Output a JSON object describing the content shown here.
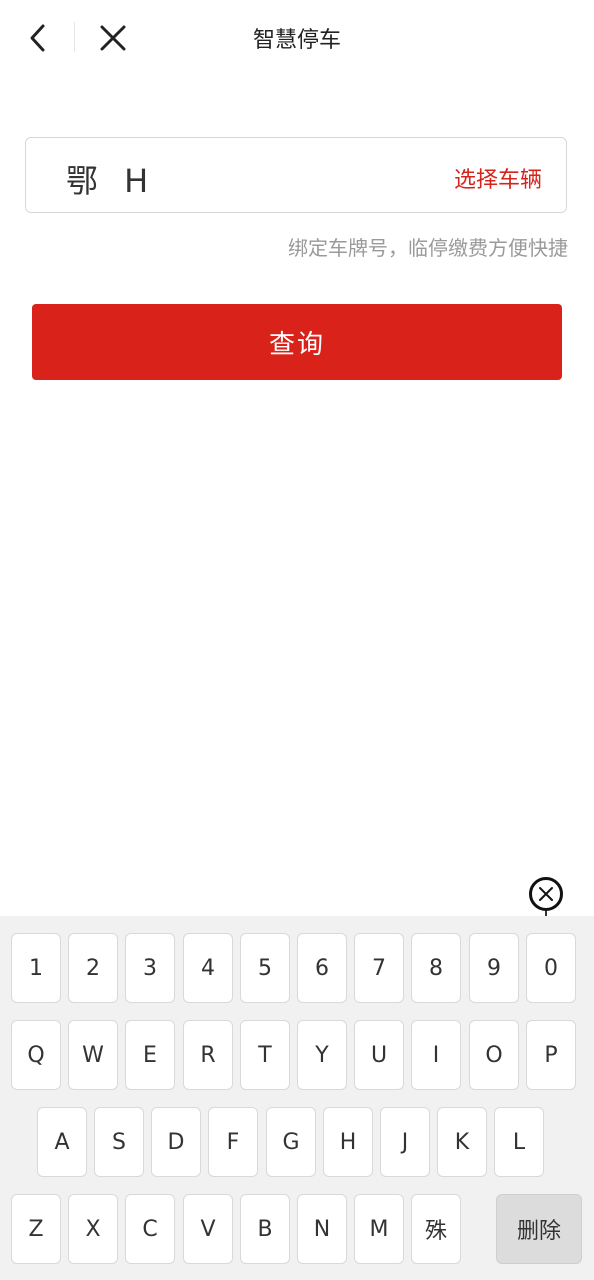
{
  "header": {
    "title": "智慧停车",
    "back_icon": "back-icon",
    "close_icon": "close-icon"
  },
  "plate_input": {
    "value": "鄂 H",
    "select_vehicle_label": "选择车辆",
    "hint": "绑定车牌号，临停缴费方便快捷"
  },
  "query_button": {
    "label": "查询"
  },
  "keyboard": {
    "dismiss_icon": "close-circle-icon",
    "row1": [
      "1",
      "2",
      "3",
      "4",
      "5",
      "6",
      "7",
      "8",
      "9",
      "0"
    ],
    "row2": [
      "Q",
      "W",
      "E",
      "R",
      "T",
      "Y",
      "U",
      "I",
      "O",
      "P"
    ],
    "row3": [
      "A",
      "S",
      "D",
      "F",
      "G",
      "H",
      "J",
      "K",
      "L"
    ],
    "row4": [
      "Z",
      "X",
      "C",
      "V",
      "B",
      "N",
      "M",
      "殊"
    ],
    "delete_label": "删除"
  },
  "colors": {
    "accent_red": "#d9221a",
    "link_red": "#d6231c",
    "hint_gray": "#9a9a9a",
    "keyboard_bg": "#f1f1f1"
  }
}
